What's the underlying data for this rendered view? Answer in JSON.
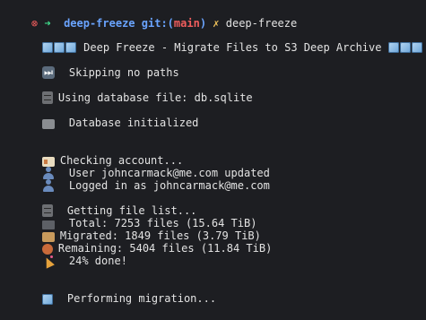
{
  "prompt": {
    "status_glyph": "⊗",
    "arrow": "➜",
    "dir": "deep-freeze",
    "git_prefix": "git:(",
    "branch": "main",
    "git_suffix": ")",
    "dirty_mark": "✗",
    "command": "deep-freeze"
  },
  "output": {
    "banner": "Deep Freeze - Migrate Files to S3 Deep Archive",
    "skipping": "Skipping no paths",
    "db_file": "Using database file: db.sqlite",
    "db_init": "Database initialized",
    "checking": "Checking account...",
    "user_updated": "User johncarmack@me.com updated",
    "logged_in": "Logged in as johncarmack@me.com",
    "getting_list": "Getting file list...",
    "total": "Total: 7253 files (15.64 TiB)",
    "migrated": "Migrated: 1849 files (3.79 TiB)",
    "remaining": "Remaining: 5404 files (11.84 TiB)",
    "done_pct": "24% done!",
    "performing": "Performing migration..."
  },
  "colors": {
    "background": "#1d1e22",
    "text": "#e3e3e3",
    "prompt_red": "#f05d5d",
    "prompt_green": "#3fd98a",
    "prompt_blue": "#6aa4ff",
    "prompt_yellow": "#f0c35b"
  },
  "icons": {
    "banner": "ice-cube-icon",
    "skipping": "next-track-icon",
    "db_file": "file-cabinet-icon",
    "db_init": "folder-icon",
    "checking": "id-card-icon",
    "user": "user-silhouette-icon",
    "getting_list": "file-cabinet-icon",
    "total": "file-drawer-icon",
    "migrated": "package-box-icon",
    "remaining": "yarn-ball-icon",
    "done": "party-popper-icon",
    "performing": "ice-cube-icon"
  }
}
